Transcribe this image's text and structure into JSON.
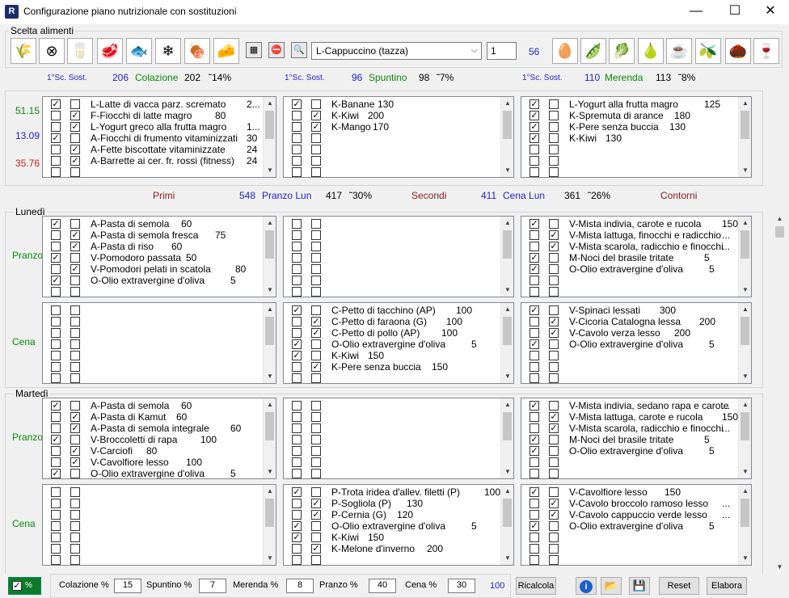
{
  "window": {
    "title": "Configurazione piano nutrizionale con sostituzioni",
    "icon": "R",
    "min": "—",
    "max": "☐",
    "close": "✕"
  },
  "scelta": {
    "label": "Scelta alimenti",
    "left_icons": [
      {
        "name": "flour-icon",
        "glyph": "🌾"
      },
      {
        "name": "no-gluten-icon",
        "glyph": "⊗"
      },
      {
        "name": "milk-icon",
        "glyph": "🥛"
      },
      {
        "name": "meat-icon",
        "glyph": "🥩"
      },
      {
        "name": "fish-icon",
        "glyph": "🐟"
      },
      {
        "name": "frozen-fish-icon",
        "glyph": "❄"
      },
      {
        "name": "ham-icon",
        "glyph": "🍖"
      },
      {
        "name": "cheese-icon",
        "glyph": "🧀"
      }
    ],
    "small_icons": [
      {
        "name": "calculator-icon",
        "glyph": "▦"
      },
      {
        "name": "stop-icon",
        "glyph": "⛔"
      },
      {
        "name": "document-search-icon",
        "glyph": "🔍"
      }
    ],
    "combo": "L-Cappuccino (tazza)",
    "qty": "1",
    "count": "56",
    "right_icons": [
      {
        "name": "eggs-icon",
        "glyph": "🥚"
      },
      {
        "name": "peas-icon",
        "glyph": "🫛"
      },
      {
        "name": "salad-icon",
        "glyph": "🥬"
      },
      {
        "name": "pear-icon",
        "glyph": "🍐"
      },
      {
        "name": "coffee-cup-icon",
        "glyph": "☕"
      },
      {
        "name": "oil-bottle-icon",
        "glyph": "🫒"
      },
      {
        "name": "nuts-icon",
        "glyph": "🌰"
      },
      {
        "name": "wine-glass-icon",
        "glyph": "🍷"
      }
    ]
  },
  "meals_top": [
    {
      "sc": "1°Sc. Sost.",
      "kcal": "206",
      "name": "Colazione",
      "tot": "202",
      "pct": "˜14%"
    },
    {
      "sc": "1°Sc. Sost.",
      "kcal": "96",
      "name": "Spuntino",
      "tot": "98",
      "pct": "˜7%"
    },
    {
      "sc": "1°Sc. Sost.",
      "kcal": "110",
      "name": "Merenda",
      "tot": "113",
      "pct": "˜8%"
    }
  ],
  "macros": [
    "51.15",
    "13.09",
    "35.76"
  ],
  "top_lists": [
    [
      {
        "c1": true,
        "c2": false,
        "n": "L-Latte di vacca parz. scremato",
        "q": "2..."
      },
      {
        "c1": false,
        "c2": true,
        "n": "F-Fiocchi di latte magro",
        "q": "80"
      },
      {
        "c1": false,
        "c2": true,
        "n": "L-Yogurt greco alla frutta magro",
        "q": "1..."
      },
      {
        "c1": true,
        "c2": false,
        "n": "A-Fiocchi di frumento vitaminizzati",
        "q": "30"
      },
      {
        "c1": false,
        "c2": true,
        "n": "A-Fette biscottate vitaminizzate",
        "q": "24"
      },
      {
        "c1": false,
        "c2": true,
        "n": "A-Barrette ai cer. fr. rossi (fitness)",
        "q": "24"
      },
      {
        "c1": false,
        "c2": false,
        "n": "",
        "q": ""
      }
    ],
    [
      {
        "c1": true,
        "c2": false,
        "n": "K-Banane",
        "q": "130"
      },
      {
        "c1": false,
        "c2": true,
        "n": "K-Kiwi",
        "q": "200"
      },
      {
        "c1": false,
        "c2": true,
        "n": "K-Mango",
        "q": "170"
      },
      {
        "c1": false,
        "c2": false,
        "n": "",
        "q": ""
      },
      {
        "c1": false,
        "c2": false,
        "n": "",
        "q": ""
      },
      {
        "c1": false,
        "c2": false,
        "n": "",
        "q": ""
      },
      {
        "c1": false,
        "c2": false,
        "n": "",
        "q": ""
      }
    ],
    [
      {
        "c1": true,
        "c2": false,
        "n": "L-Yogurt alla frutta magro",
        "q": "125"
      },
      {
        "c1": true,
        "c2": false,
        "n": "K-Spremuta di arance",
        "q": "180"
      },
      {
        "c1": true,
        "c2": false,
        "n": "K-Pere senza buccia",
        "q": "130"
      },
      {
        "c1": true,
        "c2": false,
        "n": "K-Kiwi",
        "q": "130"
      },
      {
        "c1": false,
        "c2": false,
        "n": "",
        "q": ""
      },
      {
        "c1": false,
        "c2": false,
        "n": "",
        "q": ""
      },
      {
        "c1": false,
        "c2": false,
        "n": "",
        "q": ""
      }
    ]
  ],
  "section_header": {
    "primi": "Primi",
    "pranzo_kcal": "548",
    "pranzo": "Pranzo Lun",
    "pranzo_tot": "417",
    "pranzo_pct": "˜30%",
    "secondi": "Secondi",
    "cena_kcal": "411",
    "cena": "Cena Lun",
    "cena_tot": "361",
    "cena_pct": "˜26%",
    "contorni": "Contorni"
  },
  "days": [
    {
      "name": "Lunedì",
      "meals": [
        {
          "label": "Pranzo",
          "lists": [
            [
              {
                "c1": true,
                "c2": false,
                "n": "A-Pasta di semola",
                "q": "60"
              },
              {
                "c1": false,
                "c2": true,
                "n": "A-Pasta di semola fresca",
                "q": "75"
              },
              {
                "c1": false,
                "c2": true,
                "n": "A-Pasta di riso",
                "q": "60"
              },
              {
                "c1": true,
                "c2": false,
                "n": "V-Pomodoro passata",
                "q": "50"
              },
              {
                "c1": false,
                "c2": true,
                "n": "V-Pomodori pelati in scatola",
                "q": "80"
              },
              {
                "c1": true,
                "c2": false,
                "n": "O-Olio extravergine d'oliva",
                "q": "5"
              },
              {
                "c1": false,
                "c2": false,
                "n": "",
                "q": ""
              }
            ],
            [
              {
                "c1": false,
                "c2": false,
                "n": "",
                "q": ""
              },
              {
                "c1": false,
                "c2": false,
                "n": "",
                "q": ""
              },
              {
                "c1": false,
                "c2": false,
                "n": "",
                "q": ""
              },
              {
                "c1": false,
                "c2": false,
                "n": "",
                "q": ""
              },
              {
                "c1": false,
                "c2": false,
                "n": "",
                "q": ""
              },
              {
                "c1": false,
                "c2": false,
                "n": "",
                "q": ""
              },
              {
                "c1": false,
                "c2": false,
                "n": "",
                "q": ""
              }
            ],
            [
              {
                "c1": true,
                "c2": false,
                "n": "V-Mista indivia, carote e rucola",
                "q": "150"
              },
              {
                "c1": false,
                "c2": true,
                "n": "V-Mista lattuga, finocchi e radicchio",
                "q": "..."
              },
              {
                "c1": false,
                "c2": true,
                "n": "V-Mista scarola, radicchio e finocchi",
                "q": "..."
              },
              {
                "c1": true,
                "c2": false,
                "n": "M-Noci del brasile tritate",
                "q": "5"
              },
              {
                "c1": true,
                "c2": false,
                "n": "O-Olio extravergine d'oliva",
                "q": "5"
              },
              {
                "c1": false,
                "c2": false,
                "n": "",
                "q": ""
              },
              {
                "c1": false,
                "c2": false,
                "n": "",
                "q": ""
              }
            ]
          ]
        },
        {
          "label": "Cena",
          "lists": [
            [
              {
                "c1": false,
                "c2": false,
                "n": "",
                "q": ""
              },
              {
                "c1": false,
                "c2": false,
                "n": "",
                "q": ""
              },
              {
                "c1": false,
                "c2": false,
                "n": "",
                "q": ""
              },
              {
                "c1": false,
                "c2": false,
                "n": "",
                "q": ""
              },
              {
                "c1": false,
                "c2": false,
                "n": "",
                "q": ""
              },
              {
                "c1": false,
                "c2": false,
                "n": "",
                "q": ""
              },
              {
                "c1": false,
                "c2": false,
                "n": "",
                "q": ""
              }
            ],
            [
              {
                "c1": true,
                "c2": false,
                "n": "C-Petto di tacchino (AP)",
                "q": "100"
              },
              {
                "c1": false,
                "c2": true,
                "n": "C-Petto di faraona (G)",
                "q": "100"
              },
              {
                "c1": false,
                "c2": true,
                "n": "C-Petto di pollo (AP)",
                "q": "100"
              },
              {
                "c1": true,
                "c2": false,
                "n": "O-Olio extravergine d'oliva",
                "q": "5"
              },
              {
                "c1": true,
                "c2": false,
                "n": "K-Kiwi",
                "q": "150"
              },
              {
                "c1": false,
                "c2": true,
                "n": "K-Pere senza buccia",
                "q": "150"
              },
              {
                "c1": false,
                "c2": false,
                "n": "",
                "q": ""
              }
            ],
            [
              {
                "c1": true,
                "c2": false,
                "n": "V-Spinaci lessati",
                "q": "300"
              },
              {
                "c1": false,
                "c2": true,
                "n": "V-Cicoria Catalogna lessa",
                "q": "200"
              },
              {
                "c1": false,
                "c2": true,
                "n": "V-Cavolo verza lesso",
                "q": "200"
              },
              {
                "c1": true,
                "c2": false,
                "n": "O-Olio extravergine d'oliva",
                "q": "5"
              },
              {
                "c1": false,
                "c2": false,
                "n": "",
                "q": ""
              },
              {
                "c1": false,
                "c2": false,
                "n": "",
                "q": ""
              },
              {
                "c1": false,
                "c2": false,
                "n": "",
                "q": ""
              }
            ]
          ]
        }
      ]
    },
    {
      "name": "Martedì",
      "meals": [
        {
          "label": "Pranzo",
          "lists": [
            [
              {
                "c1": true,
                "c2": false,
                "n": "A-Pasta di semola",
                "q": "60"
              },
              {
                "c1": false,
                "c2": true,
                "n": "A-Pasta di Kamut",
                "q": "60"
              },
              {
                "c1": false,
                "c2": true,
                "n": "A-Pasta di semola integrale",
                "q": "60"
              },
              {
                "c1": true,
                "c2": false,
                "n": "V-Broccoletti di rapa",
                "q": "100"
              },
              {
                "c1": false,
                "c2": true,
                "n": "V-Carciofi",
                "q": "80"
              },
              {
                "c1": false,
                "c2": true,
                "n": "V-Cavolfiore lesso",
                "q": "100"
              },
              {
                "c1": true,
                "c2": false,
                "n": "O-Olio extravergine d'oliva",
                "q": "5"
              }
            ],
            [
              {
                "c1": false,
                "c2": false,
                "n": "",
                "q": ""
              },
              {
                "c1": false,
                "c2": false,
                "n": "",
                "q": ""
              },
              {
                "c1": false,
                "c2": false,
                "n": "",
                "q": ""
              },
              {
                "c1": false,
                "c2": false,
                "n": "",
                "q": ""
              },
              {
                "c1": false,
                "c2": false,
                "n": "",
                "q": ""
              },
              {
                "c1": false,
                "c2": false,
                "n": "",
                "q": ""
              },
              {
                "c1": false,
                "c2": false,
                "n": "",
                "q": ""
              }
            ],
            [
              {
                "c1": true,
                "c2": false,
                "n": "V-Mista indivia, sedano rapa e carote",
                "q": "..."
              },
              {
                "c1": false,
                "c2": true,
                "n": "V-Mista lattuga, carote e rucola",
                "q": "150"
              },
              {
                "c1": false,
                "c2": true,
                "n": "V-Mista scarola, radicchio e finocchi",
                "q": "..."
              },
              {
                "c1": true,
                "c2": false,
                "n": "M-Noci del brasile tritate",
                "q": "5"
              },
              {
                "c1": true,
                "c2": false,
                "n": "O-Olio extravergine d'oliva",
                "q": "5"
              },
              {
                "c1": false,
                "c2": false,
                "n": "",
                "q": ""
              },
              {
                "c1": false,
                "c2": false,
                "n": "",
                "q": ""
              }
            ]
          ]
        },
        {
          "label": "Cena",
          "lists": [
            [
              {
                "c1": false,
                "c2": false,
                "n": "",
                "q": ""
              },
              {
                "c1": false,
                "c2": false,
                "n": "",
                "q": ""
              },
              {
                "c1": false,
                "c2": false,
                "n": "",
                "q": ""
              },
              {
                "c1": false,
                "c2": false,
                "n": "",
                "q": ""
              },
              {
                "c1": false,
                "c2": false,
                "n": "",
                "q": ""
              },
              {
                "c1": false,
                "c2": false,
                "n": "",
                "q": ""
              },
              {
                "c1": false,
                "c2": false,
                "n": "",
                "q": ""
              }
            ],
            [
              {
                "c1": true,
                "c2": false,
                "n": "P-Trota iridea d'allev. filetti (P)",
                "q": "100"
              },
              {
                "c1": false,
                "c2": true,
                "n": "P-Sogliola (P)",
                "q": "130"
              },
              {
                "c1": false,
                "c2": true,
                "n": "P-Cernia (G)",
                "q": "120"
              },
              {
                "c1": true,
                "c2": false,
                "n": "O-Olio extravergine d'oliva",
                "q": "5"
              },
              {
                "c1": true,
                "c2": false,
                "n": "K-Kiwi",
                "q": "150"
              },
              {
                "c1": false,
                "c2": true,
                "n": "K-Melone d'inverno",
                "q": "200"
              },
              {
                "c1": false,
                "c2": false,
                "n": "",
                "q": ""
              }
            ],
            [
              {
                "c1": true,
                "c2": false,
                "n": "V-Cavolfiore lesso",
                "q": "150"
              },
              {
                "c1": false,
                "c2": true,
                "n": "V-Cavolo broccolo ramoso lesso",
                "q": "..."
              },
              {
                "c1": false,
                "c2": true,
                "n": "V-Cavolo cappuccio verde lesso",
                "q": "..."
              },
              {
                "c1": true,
                "c2": false,
                "n": "O-Olio extravergine d'oliva",
                "q": "5"
              },
              {
                "c1": false,
                "c2": false,
                "n": "",
                "q": ""
              },
              {
                "c1": false,
                "c2": false,
                "n": "",
                "q": ""
              },
              {
                "c1": false,
                "c2": false,
                "n": "",
                "q": ""
              }
            ]
          ]
        }
      ]
    }
  ],
  "bottom": {
    "pct": "%",
    "colazione_lbl": "Colazione %",
    "colazione": "15",
    "spuntino_lbl": "Spuntino %",
    "spuntino": "7",
    "merenda_lbl": "Merenda %",
    "merenda": "8",
    "pranzo_lbl": "Pranzo %",
    "pranzo": "40",
    "cena_lbl": "Cena %",
    "cena": "30",
    "total": "100",
    "ricalcola": "Ricalcola",
    "info": "i",
    "open": "📂",
    "save": "💾",
    "reset": "Reset",
    "elabora": "Elabora"
  }
}
